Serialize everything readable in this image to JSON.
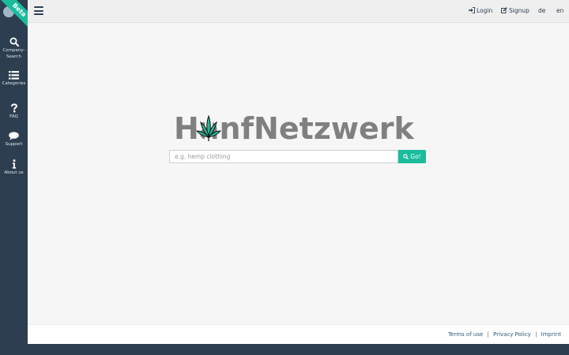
{
  "brand": {
    "beta_label": "Beta",
    "logo_text": "HanfNetzwerk"
  },
  "sidebar": {
    "items": [
      {
        "label_line1": "Company-",
        "label_line2": "Search",
        "icon": "search-icon"
      },
      {
        "label_line1": "Categories",
        "label_line2": "",
        "icon": "list-icon"
      },
      {
        "label_line1": "FAQ",
        "label_line2": "",
        "icon": "question-icon"
      },
      {
        "label_line1": "Support",
        "label_line2": "",
        "icon": "chat-bubble-icon"
      },
      {
        "label_line1": "About us",
        "label_line2": "",
        "icon": "info-icon"
      }
    ]
  },
  "topbar": {
    "login_label": "Login",
    "signup_label": "Signup",
    "lang_de": "de",
    "lang_en": "en"
  },
  "search": {
    "placeholder": "e.g. hemp clothing",
    "value": "",
    "button_label": "Go!"
  },
  "footer": {
    "terms": "Terms of use",
    "privacy": "Privacy Policy",
    "imprint": "Imprint",
    "separator": "|"
  },
  "colors": {
    "sidebar": "#2d3e50",
    "accent": "#1abc9c",
    "logo_text": "#808080",
    "leaf": "#2bb597"
  }
}
